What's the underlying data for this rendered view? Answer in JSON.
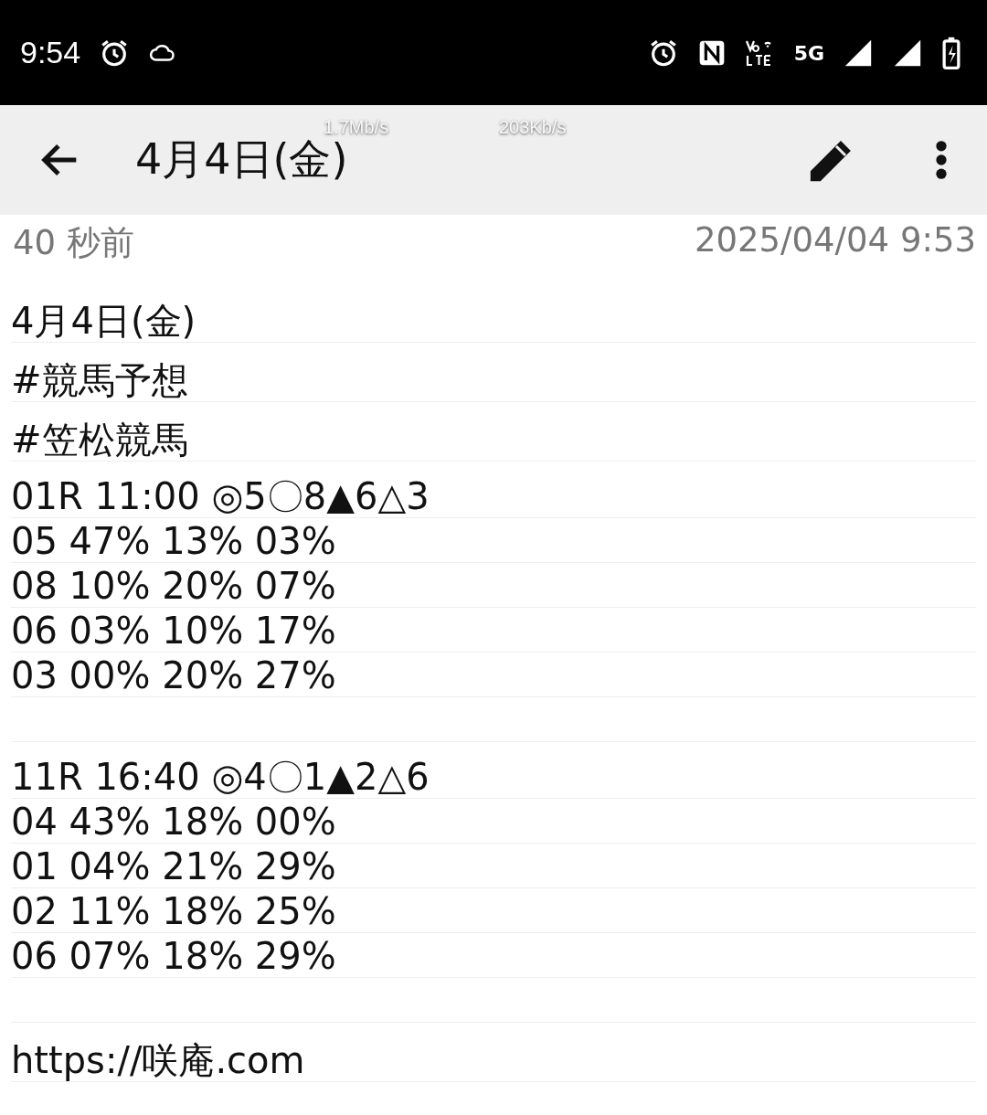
{
  "status_bar": {
    "time": "9:54",
    "network": "5G"
  },
  "toolbar": {
    "title": "4月4日(金)",
    "upload_speed": "1.7Mb/s",
    "download_speed": "203Kb/s"
  },
  "meta": {
    "relative_time": "40 秒前",
    "timestamp": "2025/04/04 9:53"
  },
  "lines": [
    {
      "kind": "tall",
      "text": "4月4日(金)"
    },
    {
      "kind": "tall",
      "text": "#競馬予想"
    },
    {
      "kind": "tall",
      "text": "#笠松競馬"
    },
    {
      "kind": "race",
      "text": "01R 11:00 ◎5〇8▲6△3"
    },
    {
      "kind": "text",
      "text": "05 47% 13% 03%"
    },
    {
      "kind": "text",
      "text": "08 10% 20% 07%"
    },
    {
      "kind": "text",
      "text": "06 03% 10% 17%"
    },
    {
      "kind": "text",
      "text": "03 00% 20% 27%"
    },
    {
      "kind": "blank"
    },
    {
      "kind": "race",
      "text": "11R 16:40 ◎4〇1▲2△6"
    },
    {
      "kind": "text",
      "text": "04 43% 18% 00%"
    },
    {
      "kind": "text",
      "text": "01 04% 21% 29%"
    },
    {
      "kind": "text",
      "text": "02 11% 18% 25%"
    },
    {
      "kind": "text",
      "text": "06 07% 18% 29%"
    },
    {
      "kind": "blank"
    },
    {
      "kind": "tall",
      "text": "https://咲庵.com"
    }
  ]
}
